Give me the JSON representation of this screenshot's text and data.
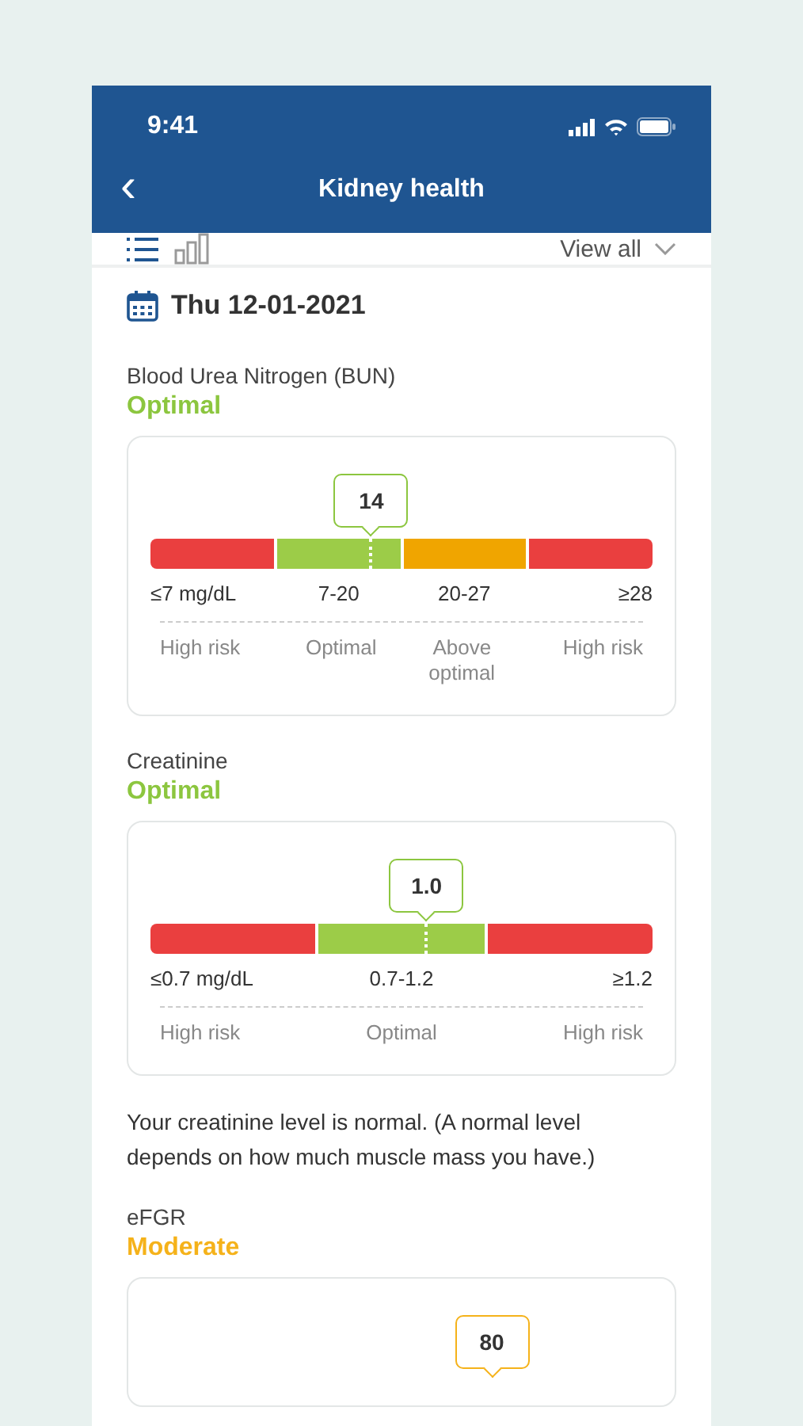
{
  "status_bar": {
    "time": "9:41"
  },
  "header": {
    "back": "‹",
    "title": "Kidney health"
  },
  "toolbar": {
    "views": [
      {
        "kind": "list",
        "selected": true
      },
      {
        "kind": "chart",
        "selected": false
      }
    ],
    "filter": "View all"
  },
  "date": "Thu 12-01-2021",
  "tests": [
    {
      "name": "Blood Urea Nitrogen (BUN)",
      "status": "Optimal",
      "color": "#8cc63f",
      "value": "14",
      "level": 0.44,
      "segments": [
        {
          "color": "#ea3f3f",
          "range": "≤7 mg/dL",
          "risk": "High risk"
        },
        {
          "color": "#9ccc48",
          "range": "7-20",
          "risk": "Optimal"
        },
        {
          "color": "#f0a500",
          "range": "20-27",
          "risk": "Above optimal"
        },
        {
          "color": "#ea3f3f",
          "range": "≥28",
          "risk": "High risk"
        }
      ]
    },
    {
      "name": "Creatinine",
      "status": "Optimal",
      "color": "#8cc63f",
      "value": "1.0",
      "level": 0.55,
      "segments": [
        {
          "color": "#ea3f3f",
          "range": "≤0.7 mg/dL",
          "risk": "High risk"
        },
        {
          "color": "#9ccc48",
          "range": "0.7-1.2",
          "risk": "Optimal"
        },
        {
          "color": "#ea3f3f",
          "range": "≥1.2",
          "risk": "High risk"
        }
      ],
      "note": "Your creatinine level is normal. (A normal level depends on how much muscle mass you have.)"
    },
    {
      "name": "eFGR",
      "status": "Moderate",
      "color": "#f5b21a",
      "value": "80",
      "level": 0.68
    }
  ]
}
